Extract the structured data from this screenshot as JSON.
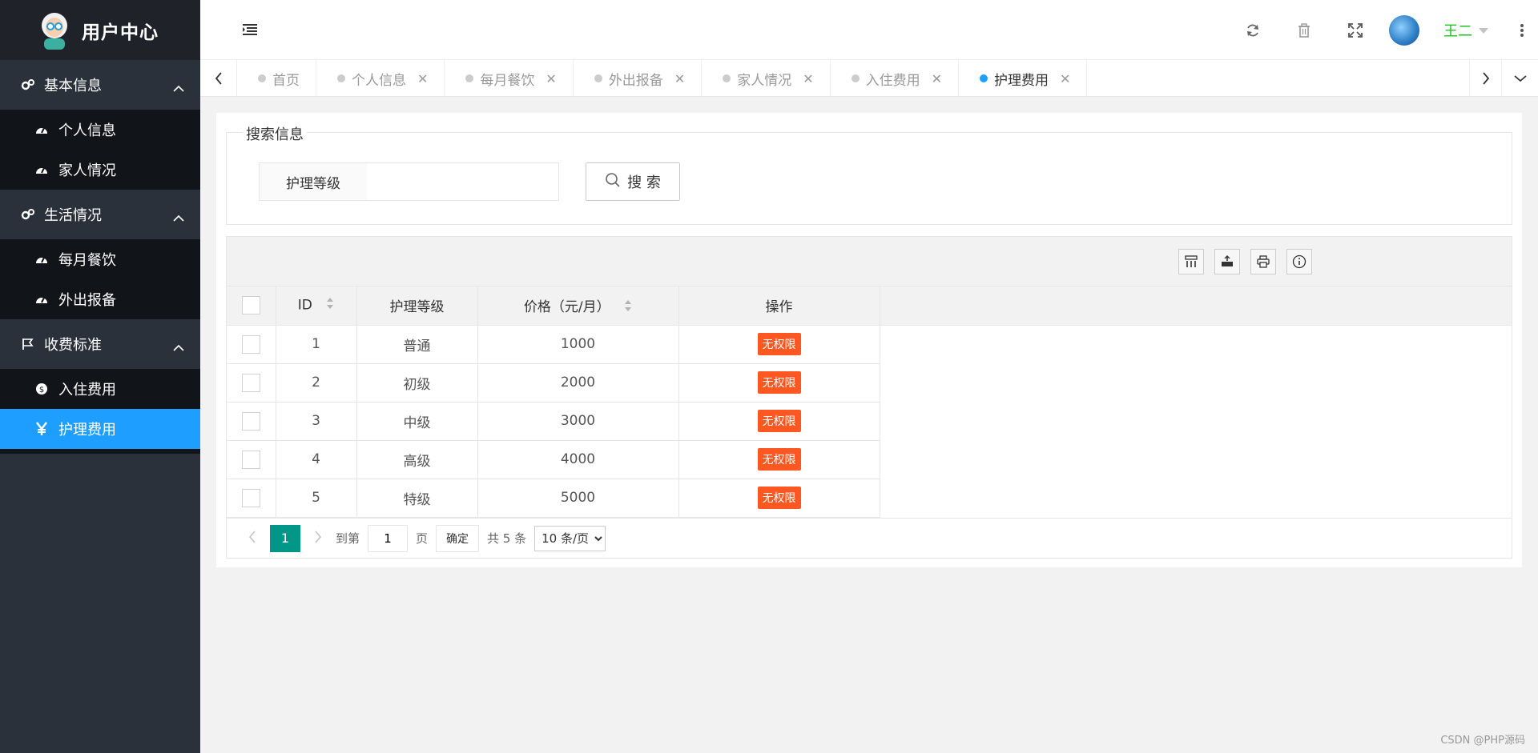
{
  "app": {
    "title": "用户中心"
  },
  "sidebar": {
    "groups": [
      {
        "label": "基本信息",
        "items": [
          {
            "label": "个人信息"
          },
          {
            "label": "家人情况"
          }
        ]
      },
      {
        "label": "生活情况",
        "items": [
          {
            "label": "每月餐饮"
          },
          {
            "label": "外出报备"
          }
        ]
      },
      {
        "label": "收费标准",
        "items": [
          {
            "label": "入住费用"
          },
          {
            "label": "护理费用",
            "active": true
          }
        ]
      }
    ]
  },
  "header": {
    "username": "王二"
  },
  "tabs": [
    {
      "label": "首页"
    },
    {
      "label": "个人信息"
    },
    {
      "label": "每月餐饮"
    },
    {
      "label": "外出报备"
    },
    {
      "label": "家人情况"
    },
    {
      "label": "入住费用"
    },
    {
      "label": "护理费用",
      "active": true
    }
  ],
  "search": {
    "legend": "搜索信息",
    "label": "护理等级",
    "value": "",
    "button": "搜 索"
  },
  "table": {
    "columns": [
      "ID",
      "护理等级",
      "价格（元/月）",
      "操作"
    ],
    "rows": [
      {
        "id": "1",
        "level": "普通",
        "price": "1000",
        "action": "无权限"
      },
      {
        "id": "2",
        "level": "初级",
        "price": "2000",
        "action": "无权限"
      },
      {
        "id": "3",
        "level": "中级",
        "price": "3000",
        "action": "无权限"
      },
      {
        "id": "4",
        "level": "高级",
        "price": "4000",
        "action": "无权限"
      },
      {
        "id": "5",
        "level": "特级",
        "price": "5000",
        "action": "无权限"
      }
    ]
  },
  "pager": {
    "current": "1",
    "goto_label": "到第",
    "goto_value": "1",
    "page_unit": "页",
    "confirm": "确定",
    "total": "共 5 条",
    "page_size": "10 条/页"
  },
  "watermark": "CSDN @PHP源码",
  "colors": {
    "primary": "#1e9fff",
    "danger": "#ff5722",
    "pager_active": "#009688",
    "sidebar_bg": "#2a313b"
  }
}
